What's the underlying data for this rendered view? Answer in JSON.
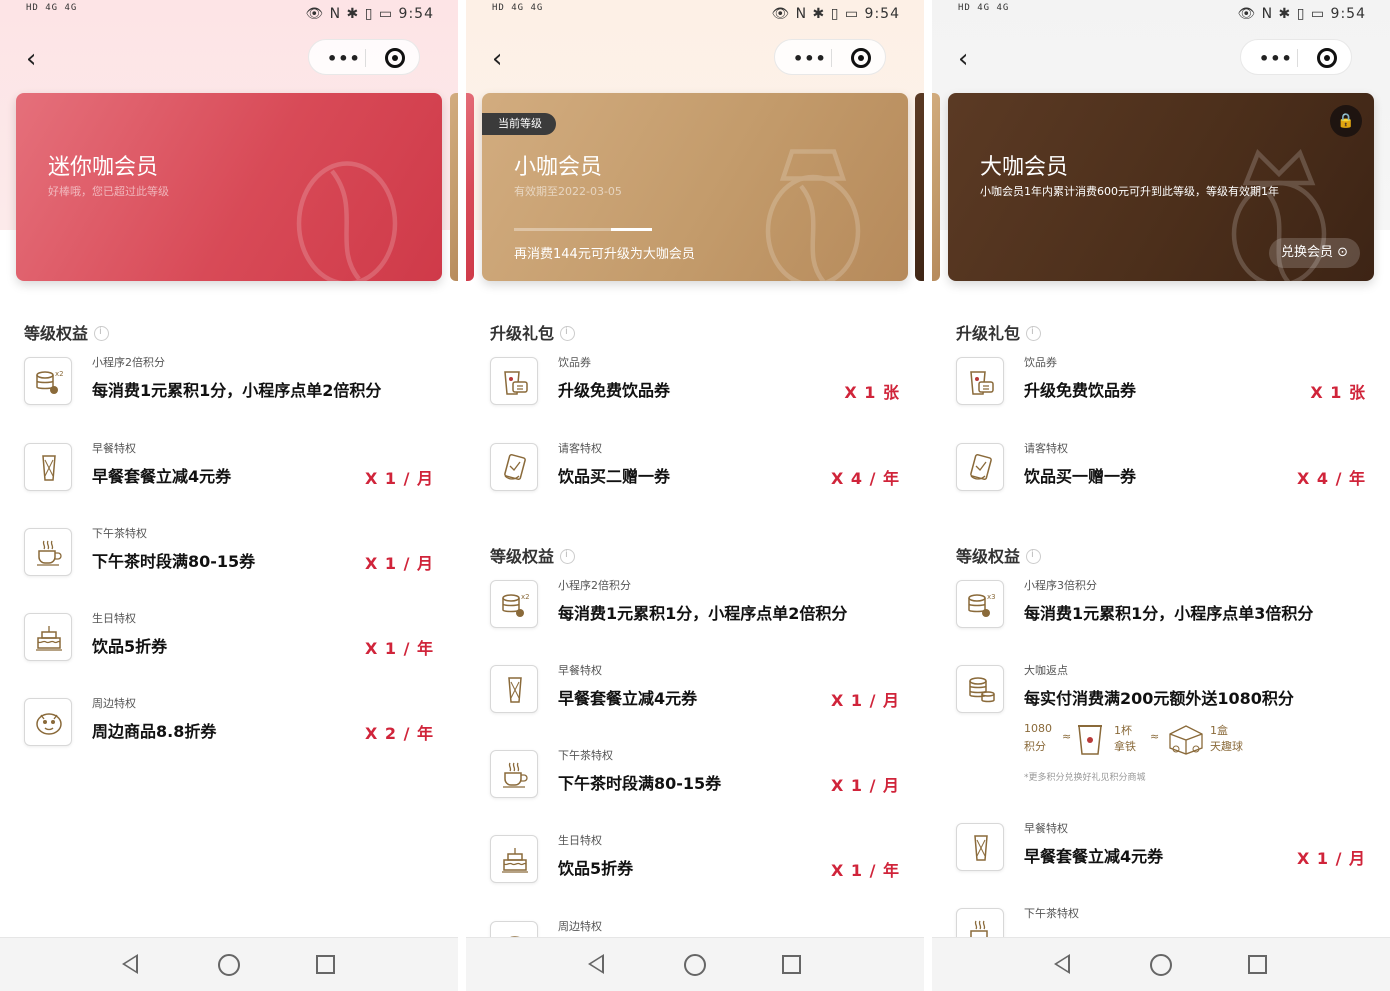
{
  "status_bar": {
    "time": "9:54",
    "left_indicators": "HD 4G 4G",
    "right_icons": "👁 Ν ✱ ▯ ▭"
  },
  "capsule": {
    "more_icon": "•••",
    "close_icon": "target"
  },
  "screens": [
    {
      "card": {
        "title": "迷你咖会员",
        "subtitle": "好棒哦，您已超过此等级"
      },
      "sections": [
        {
          "title": "等级权益",
          "items": [
            {
              "tag": "小程序2倍积分",
              "name": "每消费1元累积1分，小程序点单2倍积分",
              "qty": "",
              "icon": "points-x2-icon"
            },
            {
              "tag": "早餐特权",
              "name": "早餐套餐立减4元券",
              "qty": "X 1 / 月",
              "icon": "sandwich-icon"
            },
            {
              "tag": "下午茶特权",
              "name": "下午茶时段满80-15券",
              "qty": "X 1 / 月",
              "icon": "coffee-cup-icon"
            },
            {
              "tag": "生日特权",
              "name": "饮品5折券",
              "qty": "X 1 / 年",
              "icon": "birthday-cake-icon"
            },
            {
              "tag": "周边特权",
              "name": "周边商品8.8折券",
              "qty": "X 2 / 年",
              "icon": "merch-icon"
            }
          ]
        }
      ]
    },
    {
      "card": {
        "badge": "当前等级",
        "title": "小咖会员",
        "subtitle": "有效期至2022-03-05",
        "progress": 0.3,
        "tip": "再消费144元可升级为大咖会员"
      },
      "sections": [
        {
          "title": "升级礼包",
          "items": [
            {
              "tag": "饮品券",
              "name": "升级免费饮品券",
              "qty": "X 1 张",
              "icon": "drink-voucher-icon"
            },
            {
              "tag": "请客特权",
              "name": "饮品买二赠一券",
              "qty": "X 4 / 年",
              "icon": "treat-coupon-icon"
            }
          ]
        },
        {
          "title": "等级权益",
          "items": [
            {
              "tag": "小程序2倍积分",
              "name": "每消费1元累积1分，小程序点单2倍积分",
              "qty": "",
              "icon": "points-x2-icon"
            },
            {
              "tag": "早餐特权",
              "name": "早餐套餐立减4元券",
              "qty": "X 1 / 月",
              "icon": "sandwich-icon"
            },
            {
              "tag": "下午茶特权",
              "name": "下午茶时段满80-15券",
              "qty": "X 1 / 月",
              "icon": "coffee-cup-icon"
            },
            {
              "tag": "生日特权",
              "name": "饮品5折券",
              "qty": "X 1 / 年",
              "icon": "birthday-cake-icon"
            },
            {
              "tag": "周边特权",
              "name": "",
              "qty": "",
              "icon": "merch-icon"
            }
          ]
        }
      ]
    },
    {
      "card": {
        "title": "大咖会员",
        "subtitle": "小咖会员1年内累计消费600元可升到此等级，等级有效期1年",
        "exchange": "兑换会员 ⊙",
        "lock_icon": "🔒"
      },
      "sections": [
        {
          "title": "升级礼包",
          "items": [
            {
              "tag": "饮品券",
              "name": "升级免费饮品券",
              "qty": "X 1 张",
              "icon": "drink-voucher-icon"
            },
            {
              "tag": "请客特权",
              "name": "饮品买一赠一券",
              "qty": "X 4 / 年",
              "icon": "treat-coupon-icon"
            }
          ]
        },
        {
          "title": "等级权益",
          "items": [
            {
              "tag": "小程序3倍积分",
              "name": "每消费1元累积1分，小程序点单3倍积分",
              "qty": "",
              "icon": "points-x3-icon"
            },
            {
              "tag": "大咖返点",
              "name": "每实付消费满200元额外送1080积分",
              "qty": "",
              "icon": "coin-stack-icon"
            },
            {
              "tag": "早餐特权",
              "name": "早餐套餐立减4元券",
              "qty": "X 1 / 月",
              "icon": "sandwich-icon"
            },
            {
              "tag": "下午茶特权",
              "name": "",
              "qty": "",
              "icon": "coffee-cup-icon"
            }
          ]
        }
      ],
      "points_equiv": {
        "a1": "1080",
        "a2": "积分",
        "eq1": "≈",
        "b1": "1杯",
        "b2": "拿铁",
        "eq2": "≈",
        "c1": "1盒",
        "c2": "天趣球",
        "note": "*更多积分兑换好礼见积分商城"
      }
    }
  ],
  "colors": {
    "qty_red": "#d0243a",
    "pink_card": "#d84a57",
    "gold_card": "#c39b6b",
    "brown_card": "#4c2f1b"
  }
}
